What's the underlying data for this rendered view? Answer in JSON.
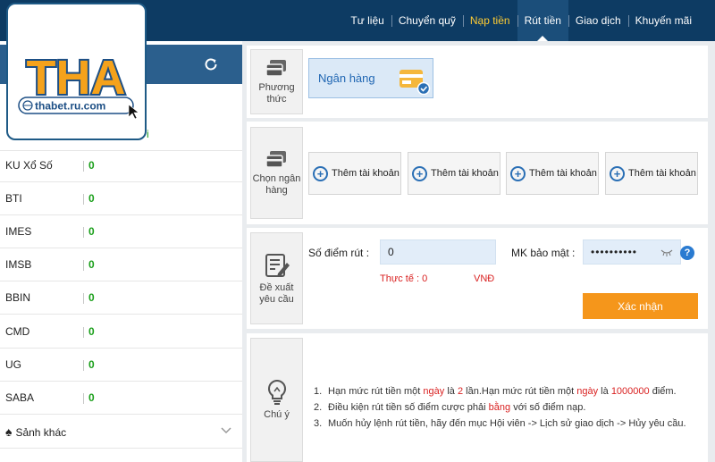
{
  "logo": {
    "text": "THA",
    "domain": "thabet.ru.com"
  },
  "nav": {
    "items": [
      {
        "label": "Tư liệu",
        "state": "normal"
      },
      {
        "label": "Chuyển quỹ",
        "state": "normal"
      },
      {
        "label": "Nạp tiền",
        "state": "highlight"
      },
      {
        "label": "Rút tiền",
        "state": "active"
      },
      {
        "label": "Giao dịch",
        "state": "normal"
      },
      {
        "label": "Khuyến mãi",
        "state": "normal"
      }
    ]
  },
  "sidebar": {
    "partial_row": {
      "fragment": "i"
    },
    "games": [
      {
        "name": "KU Xổ Số",
        "score": "0"
      },
      {
        "name": "BTI",
        "score": "0"
      },
      {
        "name": "IMES",
        "score": "0"
      },
      {
        "name": "IMSB",
        "score": "0"
      },
      {
        "name": "BBIN",
        "score": "0"
      },
      {
        "name": "CMD",
        "score": "0"
      },
      {
        "name": "UG",
        "score": "0"
      },
      {
        "name": "SABA",
        "score": "0"
      }
    ],
    "other": {
      "label": "Sảnh khác"
    }
  },
  "method": {
    "tile_label": "Phương thức",
    "selected": "Ngân hàng"
  },
  "bank": {
    "tile_label": "Chọn ngân hàng",
    "add_buttons": [
      "Thêm tài khoản",
      "Thêm tài khoản",
      "Thêm tài khoản",
      "Thêm tài khoản"
    ]
  },
  "form": {
    "tile_label": "Đề xuất yêu cầu",
    "points_label": "Số điểm rút :",
    "points_value": "0",
    "password_label": "MK bảo mật :",
    "password_value": "••••••••••",
    "actual_label": "Thực tế : 0",
    "currency": "VNĐ",
    "help": "?",
    "confirm_label": "Xác nhận"
  },
  "notes": {
    "tile_label": "Chú ý",
    "n1": "1.",
    "n1_a": "Hạn mức rút tiền một ",
    "n1_b": "ngày",
    "n1_c": " là ",
    "n1_d": "2",
    "n1_e": " lần.Hạn mức rút tiền một ",
    "n1_f": "ngày",
    "n1_g": " là ",
    "n1_h": "1000000",
    "n1_i": " điểm.",
    "n2": "2.",
    "n2_a": "Điều kiện rút tiền số điểm cược phải ",
    "n2_b": "bằng",
    "n2_c": " với số điểm nạp.",
    "n3": "3.",
    "n3_a": "Muốn hủy lệnh rút tiền, hãy đến mục Hội viên -> Lịch sử giao dịch -> Hủy yêu cầu."
  },
  "colors": {
    "topbar": "#0d3b63",
    "accent_orange": "#f5961b",
    "score_green": "#1a9f1a",
    "warning_red": "#d92121",
    "link_blue": "#2167b3"
  }
}
